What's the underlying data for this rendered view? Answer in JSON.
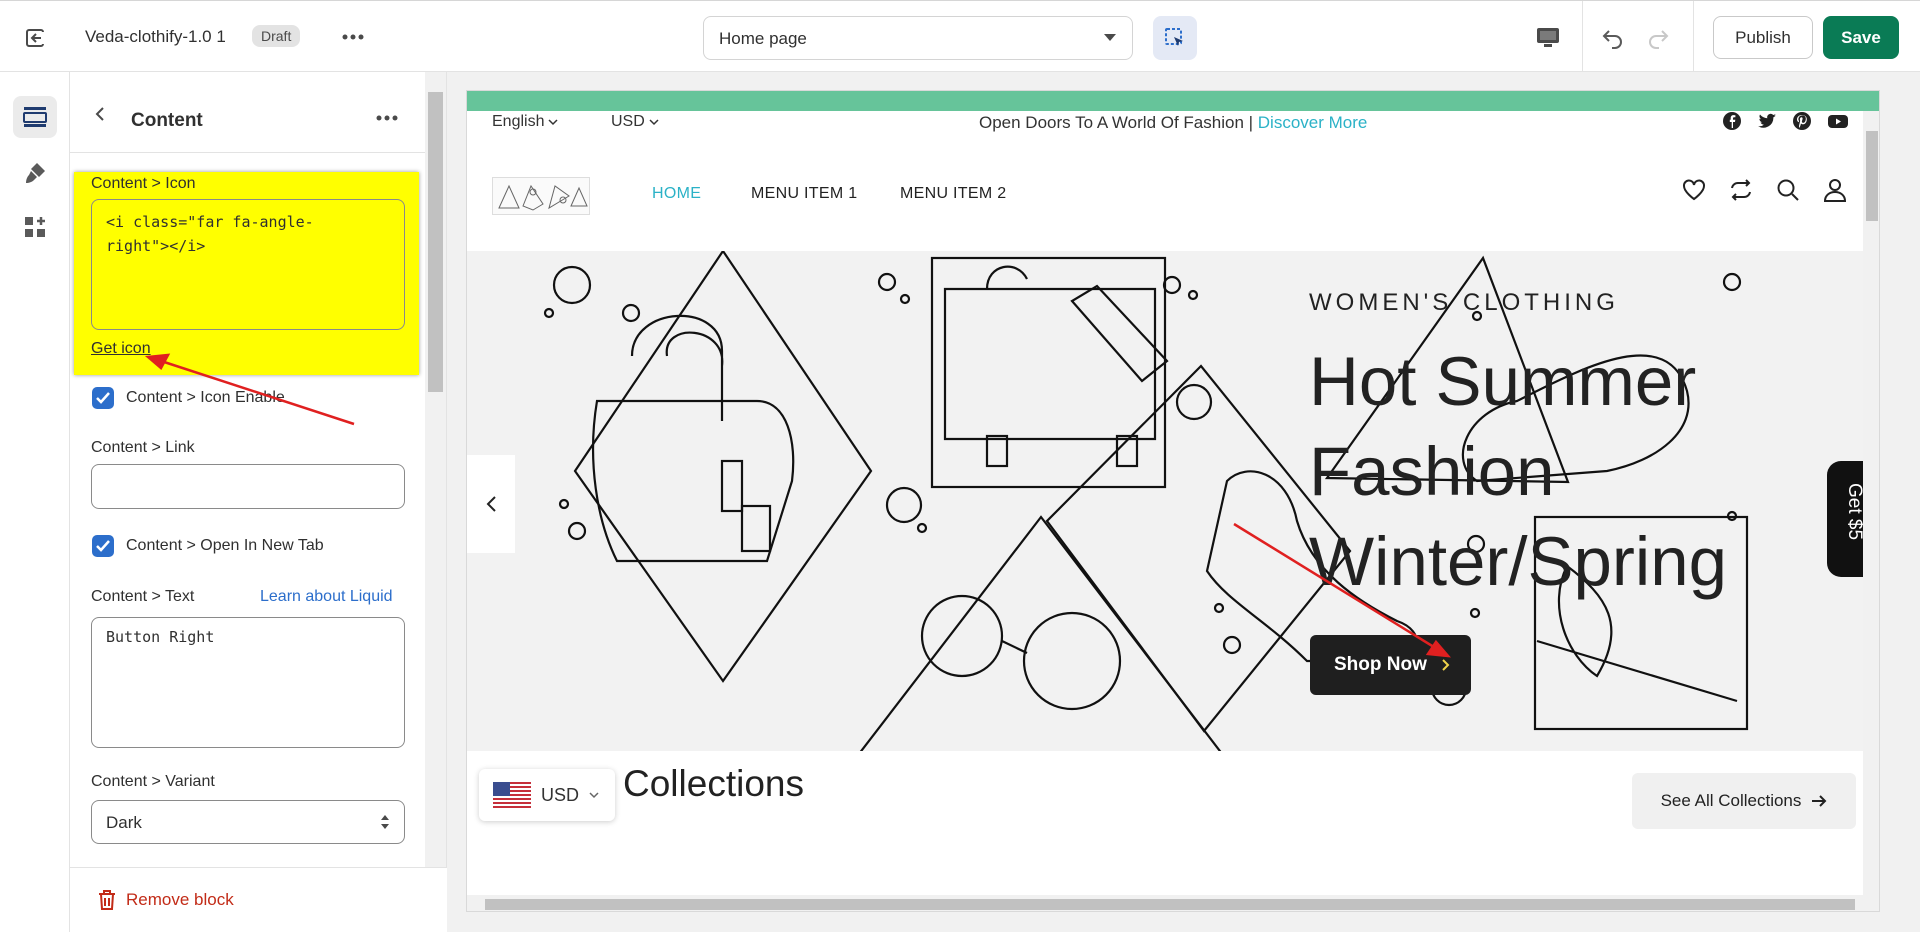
{
  "topbar": {
    "theme_name": "Veda-clothify-1.0 1",
    "badge": "Draft",
    "page_select": "Home page",
    "publish_label": "Publish",
    "save_label": "Save"
  },
  "panel": {
    "title": "Content",
    "icon_label": "Content > Icon",
    "icon_code": "<i class=\"far fa-angle-\nright\"></i>",
    "get_icon": "Get icon",
    "icon_enable_label": "Content > Icon Enable",
    "link_label": "Content > Link",
    "link_value": "",
    "new_tab_label": "Content > Open In New Tab",
    "text_label": "Content > Text",
    "learn_liquid": "Learn about Liquid",
    "text_value": "Button Right",
    "variant_label": "Content > Variant",
    "variant_value": "Dark",
    "remove_block": "Remove block"
  },
  "preview": {
    "language": "English",
    "currency": "USD",
    "announcement": "Open Doors To A World Of Fashion |",
    "announcement_link": "Discover More",
    "nav": [
      "HOME",
      "MENU ITEM 1",
      "MENU ITEM 2"
    ],
    "hero_subtitle": "WOMEN'S CLOTHING",
    "hero_title": "Hot Summer Fashion Winter/Spring",
    "shop_now": "Shop Now",
    "get5": "Get $5",
    "collections_title": "Collections",
    "see_all": "See All Collections",
    "currency_popup": "USD"
  },
  "colors": {
    "save_green": "#0a7b55",
    "highlight_yellow": "#ffff00",
    "link_teal": "#2bb2c7",
    "annotation_red": "#e02020",
    "top_strip_green": "#66c49a"
  }
}
